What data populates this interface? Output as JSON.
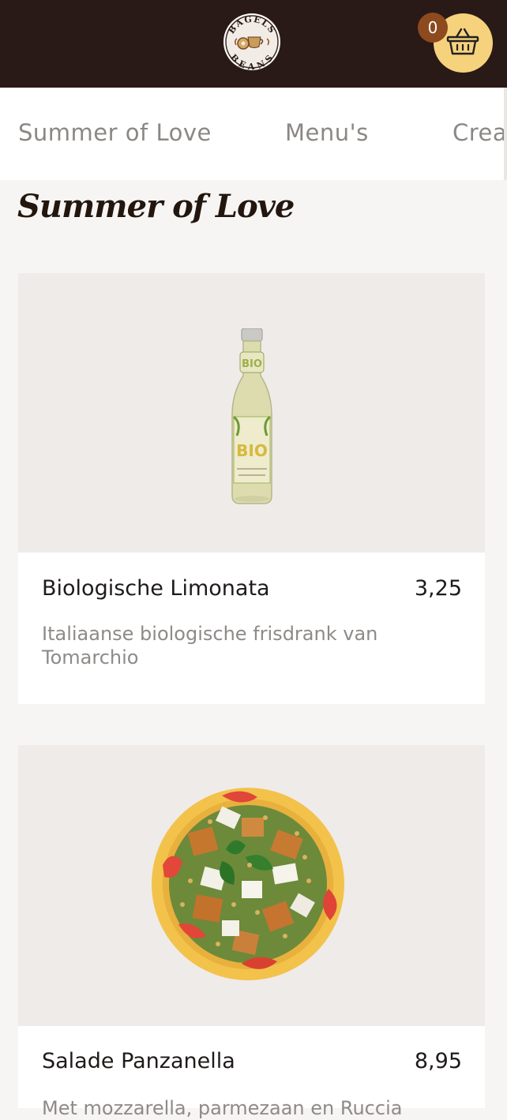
{
  "header": {
    "logo_top": "BAGELS",
    "logo_bottom": "BEANS",
    "cart_count": "0"
  },
  "categories": [
    "Summer of Love",
    "Menu's",
    "Cream"
  ],
  "section": {
    "title": "Summer of Love"
  },
  "products": [
    {
      "name": "Biologische Limonata",
      "price": "3,25",
      "description": "Italiaanse biologische frisdrank van Tomarchio"
    },
    {
      "name": "Salade Panzanella",
      "price": "8,95",
      "description": "Met mozzarella, parmezaan en Ruccia"
    }
  ],
  "colors": {
    "header_bg": "#2a1a17",
    "cart_bg": "#f6d27c",
    "badge_bg": "#8d4a1e",
    "page_bg": "#f7f5f3"
  }
}
